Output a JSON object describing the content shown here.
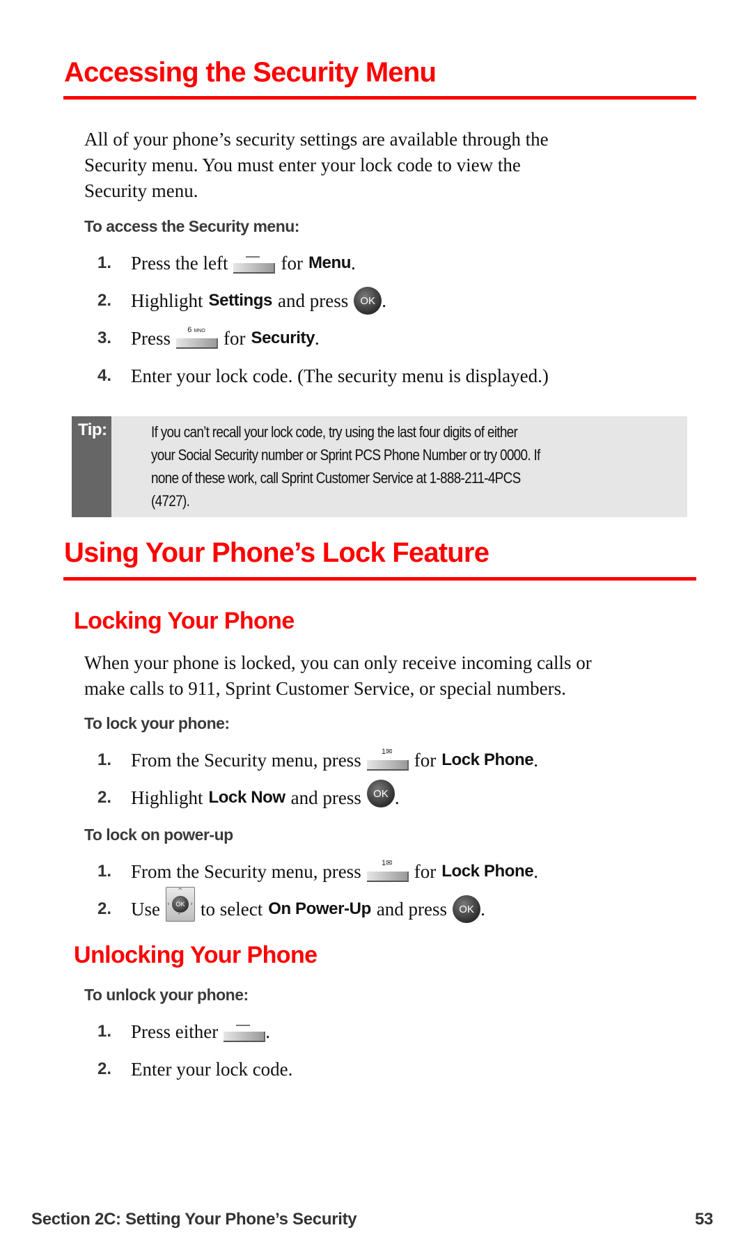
{
  "section1": {
    "title": "Accessing the Security Menu",
    "intro_lines": [
      "All of your phone’s security settings are available through the",
      "Security menu. You must enter your lock code to view the",
      "Security menu."
    ],
    "procedure_title": "To access the Security menu:",
    "steps": [
      {
        "num": "1.",
        "pre": "Press the left",
        "icon": "left-softkey-icon",
        "mid": "for",
        "bold": "Menu",
        "post": "."
      },
      {
        "num": "2.",
        "pre": "Highlight",
        "bold": "Settings",
        "mid": "and press",
        "icon": "ok-button-icon",
        "icon_label": "OK",
        "post": "."
      },
      {
        "num": "3.",
        "pre": "Press",
        "icon": "key-6-icon",
        "icon_label": "6",
        "icon_sublabel": "MNO",
        "mid": "for",
        "bold": "Security",
        "post": "."
      },
      {
        "num": "4.",
        "text": "Enter your lock code. (The security menu is displayed.)"
      }
    ]
  },
  "tip": {
    "label": "Tip:",
    "lines": [
      "If you can’t recall your lock code, try using the last four digits of either",
      "your Social Security number or Sprint PCS Phone Number or try 0000. If",
      "none of these work, call Sprint Customer Service at 1-888-211-4PCS",
      "(4727)."
    ]
  },
  "section2": {
    "title": "Using Your Phone’s Lock Feature",
    "locking": {
      "title": "Locking Your Phone",
      "intro_lines": [
        "When your phone is locked, you can only receive incoming calls or",
        "make calls to 911, Sprint Customer Service, or special numbers."
      ],
      "lock_procedure_title": "To lock your phone:",
      "lock_steps": [
        {
          "num": "1.",
          "pre": "From the Security menu, press",
          "icon": "key-1-icon",
          "icon_label": "1",
          "mid": "for",
          "bold": "Lock Phone",
          "post": "."
        },
        {
          "num": "2.",
          "pre": "Highlight",
          "bold": "Lock Now",
          "mid": "and press",
          "icon": "ok-button-icon",
          "icon_label": "OK",
          "post": "."
        }
      ],
      "powerup_procedure_title": "To lock on power-up",
      "powerup_steps": [
        {
          "num": "1.",
          "pre": "From the Security menu, press",
          "icon": "key-1-icon",
          "icon_label": "1",
          "mid": "for",
          "bold": "Lock Phone",
          "post": "."
        },
        {
          "num": "2.",
          "pre": "Use",
          "icon": "navigation-key-icon",
          "icon_label": "OK",
          "mid": "to select",
          "bold": "On Power-Up",
          "mid2": "and press",
          "icon2": "ok-button-icon",
          "icon2_label": "OK",
          "post": "."
        }
      ]
    },
    "unlocking": {
      "title": "Unlocking Your Phone",
      "procedure_title": "To unlock your phone:",
      "steps": [
        {
          "num": "1.",
          "pre": "Press either",
          "icon": "softkey-icon",
          "post": "."
        },
        {
          "num": "2.",
          "text": "Enter your lock code."
        }
      ]
    }
  },
  "footer": {
    "section": "Section 2C: Setting Your Phone’s Security",
    "page": "53"
  },
  "colors": {
    "heading": "#ff0000",
    "tip_label_bg": "#666666",
    "tip_bg": "#e6e6e6"
  }
}
